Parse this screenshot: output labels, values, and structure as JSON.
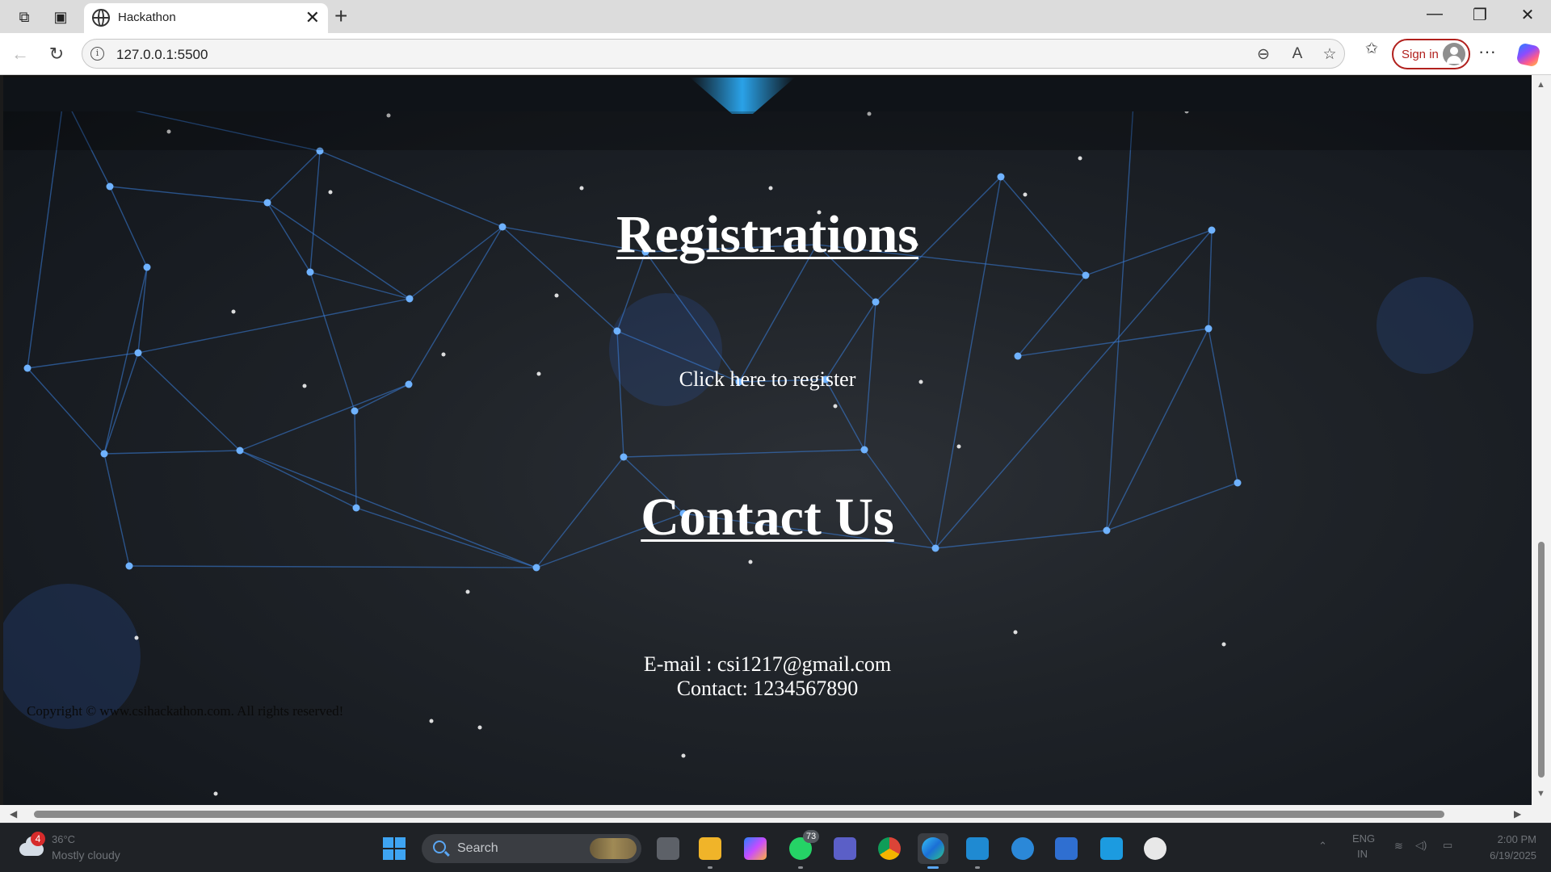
{
  "browser": {
    "tab_title": "Hackathon",
    "url": "127.0.0.1:5500",
    "signin_label": "Sign in",
    "new_tab_symbol": "+",
    "more_symbol": "···"
  },
  "page": {
    "registrations_heading": "Registrations",
    "register_link": "Click here to register",
    "contact_heading": "Contact Us",
    "email_line": "E-mail : csi1217@gmail.com",
    "phone_line": "Contact: 1234567890",
    "copyright": "Copyright © www.csihackathon.com. All rights reserved!"
  },
  "taskbar": {
    "weather_badge": "4",
    "weather_temp": "36°C",
    "weather_condition": "Mostly cloudy",
    "search_label": "Search",
    "whatsapp_count": "73",
    "lang_top": "ENG",
    "lang_bottom": "IN",
    "time": "2:00 PM",
    "date": "6/19/2025"
  },
  "colors": {
    "accent_blue": "#2aa2e8",
    "network_line": "#3b82e0",
    "signin_red": "#b1201d"
  }
}
